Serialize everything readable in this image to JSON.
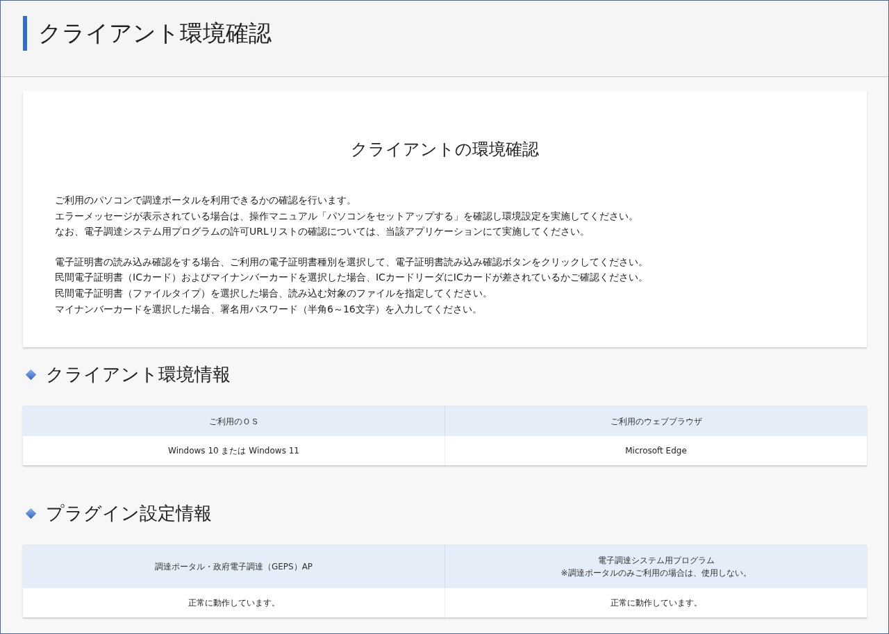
{
  "page_title": "クライアント環境確認",
  "intro": {
    "title": "クライアントの環境確認",
    "paragraphs": [
      [
        "ご利用のパソコンで調達ポータルを利用できるかの確認を行います。",
        "エラーメッセージが表示されている場合は、操作マニュアル「パソコンをセットアップする」を確認し環境設定を実施してください。",
        "なお、電子調達システム用プログラムの許可URLリストの確認については、当該アプリケーションにて実施してください。"
      ],
      [
        "電子証明書の読み込み確認をする場合、ご利用の電子証明書種別を選択して、電子証明書読み込み確認ボタンをクリックしてください。",
        "民間電子証明書（ICカード）およびマイナンバーカードを選択した場合、ICカードリーダにICカードが差されているかご確認ください。",
        "民間電子証明書（ファイルタイプ）を選択した場合、読み込む対象のファイルを指定してください。",
        "マイナンバーカードを選択した場合、署名用パスワード（半角6～16文字）を入力してください。"
      ]
    ]
  },
  "sections": [
    {
      "title": "クライアント環境情報",
      "table": {
        "columns": [
          {
            "label": "ご利用のＯＳ"
          },
          {
            "label": "ご利用のウェブブラウザ"
          }
        ],
        "rows": [
          [
            "Windows 10 または Windows 11",
            "Microsoft Edge"
          ]
        ]
      }
    },
    {
      "title": "プラグイン設定情報",
      "table": {
        "columns": [
          {
            "label": "調達ポータル・政府電子調達（GEPS）AP"
          },
          {
            "label": "電子調達システム用プログラム",
            "note": "※調達ポータルのみご利用の場合は、使用しない。"
          }
        ],
        "rows": [
          [
            "正常に動作しています。",
            "正常に動作しています。"
          ]
        ]
      }
    }
  ]
}
